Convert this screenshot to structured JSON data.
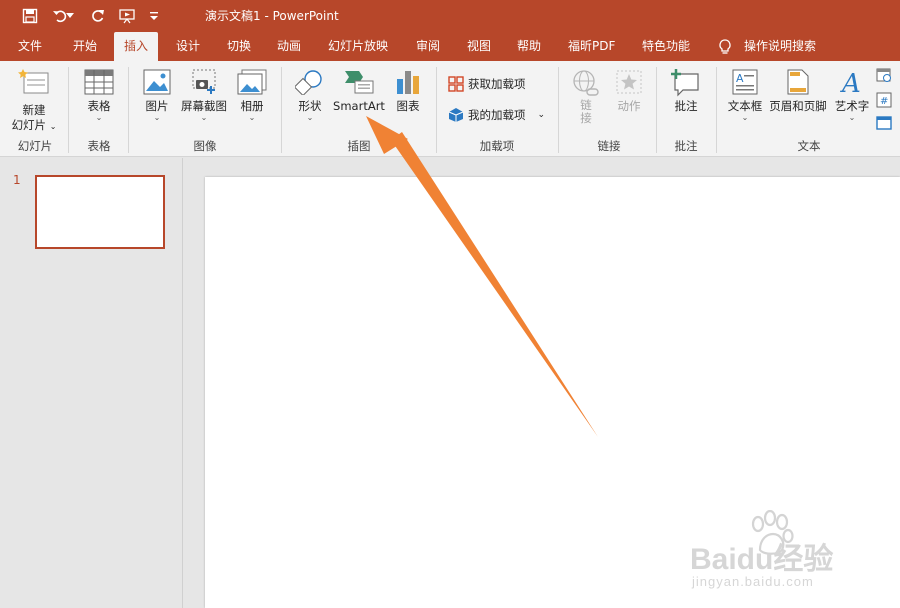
{
  "app": {
    "title": "演示文稿1  -  PowerPoint"
  },
  "tabs": [
    "文件",
    "开始",
    "插入",
    "设计",
    "切换",
    "动画",
    "幻灯片放映",
    "审阅",
    "视图",
    "帮助",
    "福昕PDF",
    "特色功能",
    "操作说明搜索"
  ],
  "ribbon": {
    "new_slide": "新建\n幻灯片",
    "table": "表格",
    "picture": "图片",
    "screenshot": "屏幕截图",
    "album": "相册",
    "shapes": "形状",
    "smartart": "SmartArt",
    "chart": "图表",
    "get_addins": "获取加载项",
    "my_addins": "我的加载项",
    "link": "链\n接",
    "action": "动作",
    "comment": "批注",
    "textbox": "文本框",
    "header_footer": "页眉和页脚",
    "wordart": "艺术字",
    "groups": {
      "slides": "幻灯片",
      "tables": "表格",
      "images": "图像",
      "illustrations": "插图",
      "addins": "加载项",
      "links": "链接",
      "comments": "批注",
      "text": "文本"
    }
  },
  "slides": {
    "current_number": "1"
  },
  "watermark": {
    "brand": "Baidu经验",
    "url": "jingyan.baidu.com"
  },
  "colors": {
    "accent": "#b7472a",
    "annotation_arrow": "#f08234"
  }
}
